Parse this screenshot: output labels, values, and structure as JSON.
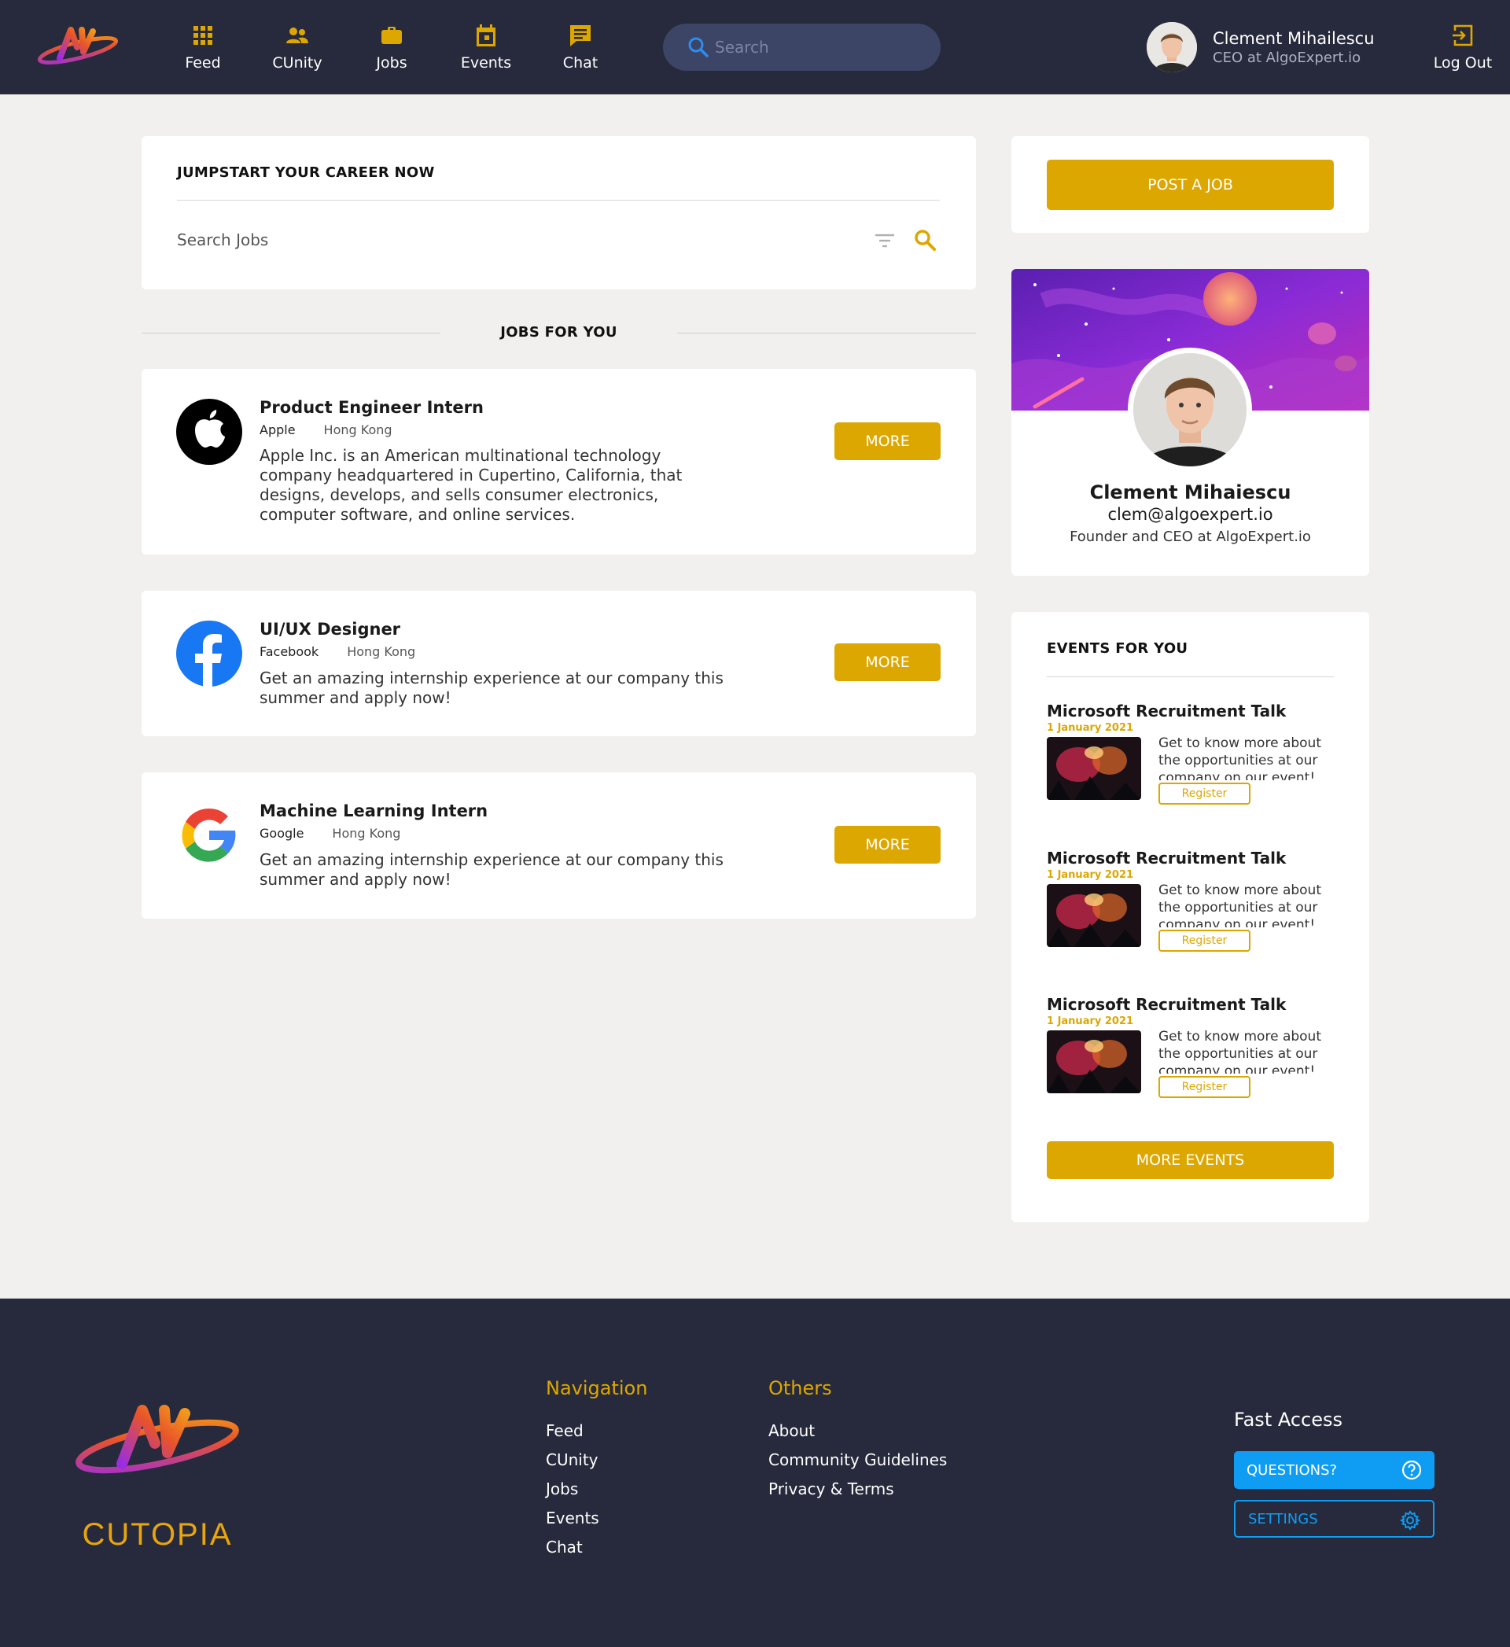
{
  "header": {
    "nav": [
      {
        "label": "Feed",
        "icon": "grid-icon"
      },
      {
        "label": "CUnity",
        "icon": "people-icon"
      },
      {
        "label": "Jobs",
        "icon": "briefcase-icon"
      },
      {
        "label": "Events",
        "icon": "calendar-icon"
      },
      {
        "label": "Chat",
        "icon": "chat-icon"
      }
    ],
    "search_placeholder": "Search",
    "user": {
      "name": "Clement Mihailescu",
      "role": "CEO at AlgoExpert.io"
    },
    "logout_label": "Log Out"
  },
  "colors": {
    "accent": "#dca700",
    "header_bg": "#272a3c",
    "search_bg": "#3d4566",
    "fast_access_blue": "#0f9cf3",
    "page_bg": "#f1f0ee"
  },
  "jumpstart": {
    "title": "JUMPSTART YOUR CAREER NOW",
    "search_placeholder": "Search Jobs"
  },
  "jobs_section_title": "JOBS FOR YOU",
  "jobs": [
    {
      "title": "Product Engineer Intern",
      "company": "Apple",
      "location": "Hong Kong",
      "logo": "apple-logo",
      "description": "Apple Inc. is an American multinational technology company headquartered in Cupertino, California, that designs, develops, and sells consumer electronics, computer software, and online services.",
      "button": "MORE"
    },
    {
      "title": "UI/UX Designer",
      "company": "Facebook",
      "location": "Hong Kong",
      "logo": "facebook-logo",
      "description": "Get an amazing internship experience at our company this summer and apply now!",
      "button": "MORE"
    },
    {
      "title": "Machine Learning Intern",
      "company": "Google",
      "location": "Hong Kong",
      "logo": "google-logo",
      "description": "Get an amazing internship experience at our company this summer and apply now!",
      "button": "MORE"
    }
  ],
  "post_job_label": "POST A JOB",
  "profile_card": {
    "name": "Clement Mihaiescu",
    "email": "clem@algoexpert.io",
    "role": "Founder and CEO at AlgoExpert.io"
  },
  "events_section": {
    "title": "EVENTS FOR YOU",
    "events": [
      {
        "title": "Microsoft Recruitment Talk",
        "date": "1 January 2021",
        "description": "Get to know more about the opportunities at our company on our event!",
        "register_label": "Register"
      },
      {
        "title": "Microsoft Recruitment Talk",
        "date": "1 January 2021",
        "description": "Get to know more about the opportunities at our company on our event!",
        "register_label": "Register"
      },
      {
        "title": "Microsoft Recruitment Talk",
        "date": "1 January 2021",
        "description": "Get to know more about the opportunities at our company on our event!",
        "register_label": "Register"
      }
    ],
    "more_label": "MORE EVENTS"
  },
  "footer": {
    "brand": "CUTOPIA",
    "navigation": {
      "title": "Navigation",
      "links": [
        "Feed",
        "CUnity",
        "Jobs",
        "Events",
        "Chat"
      ]
    },
    "others": {
      "title": "Others",
      "links": [
        "About",
        "Community Guidelines",
        "Privacy & Terms"
      ]
    },
    "fast_access": {
      "title": "Fast Access",
      "questions_label": "QUESTIONS?",
      "settings_label": "SETTINGS"
    }
  }
}
